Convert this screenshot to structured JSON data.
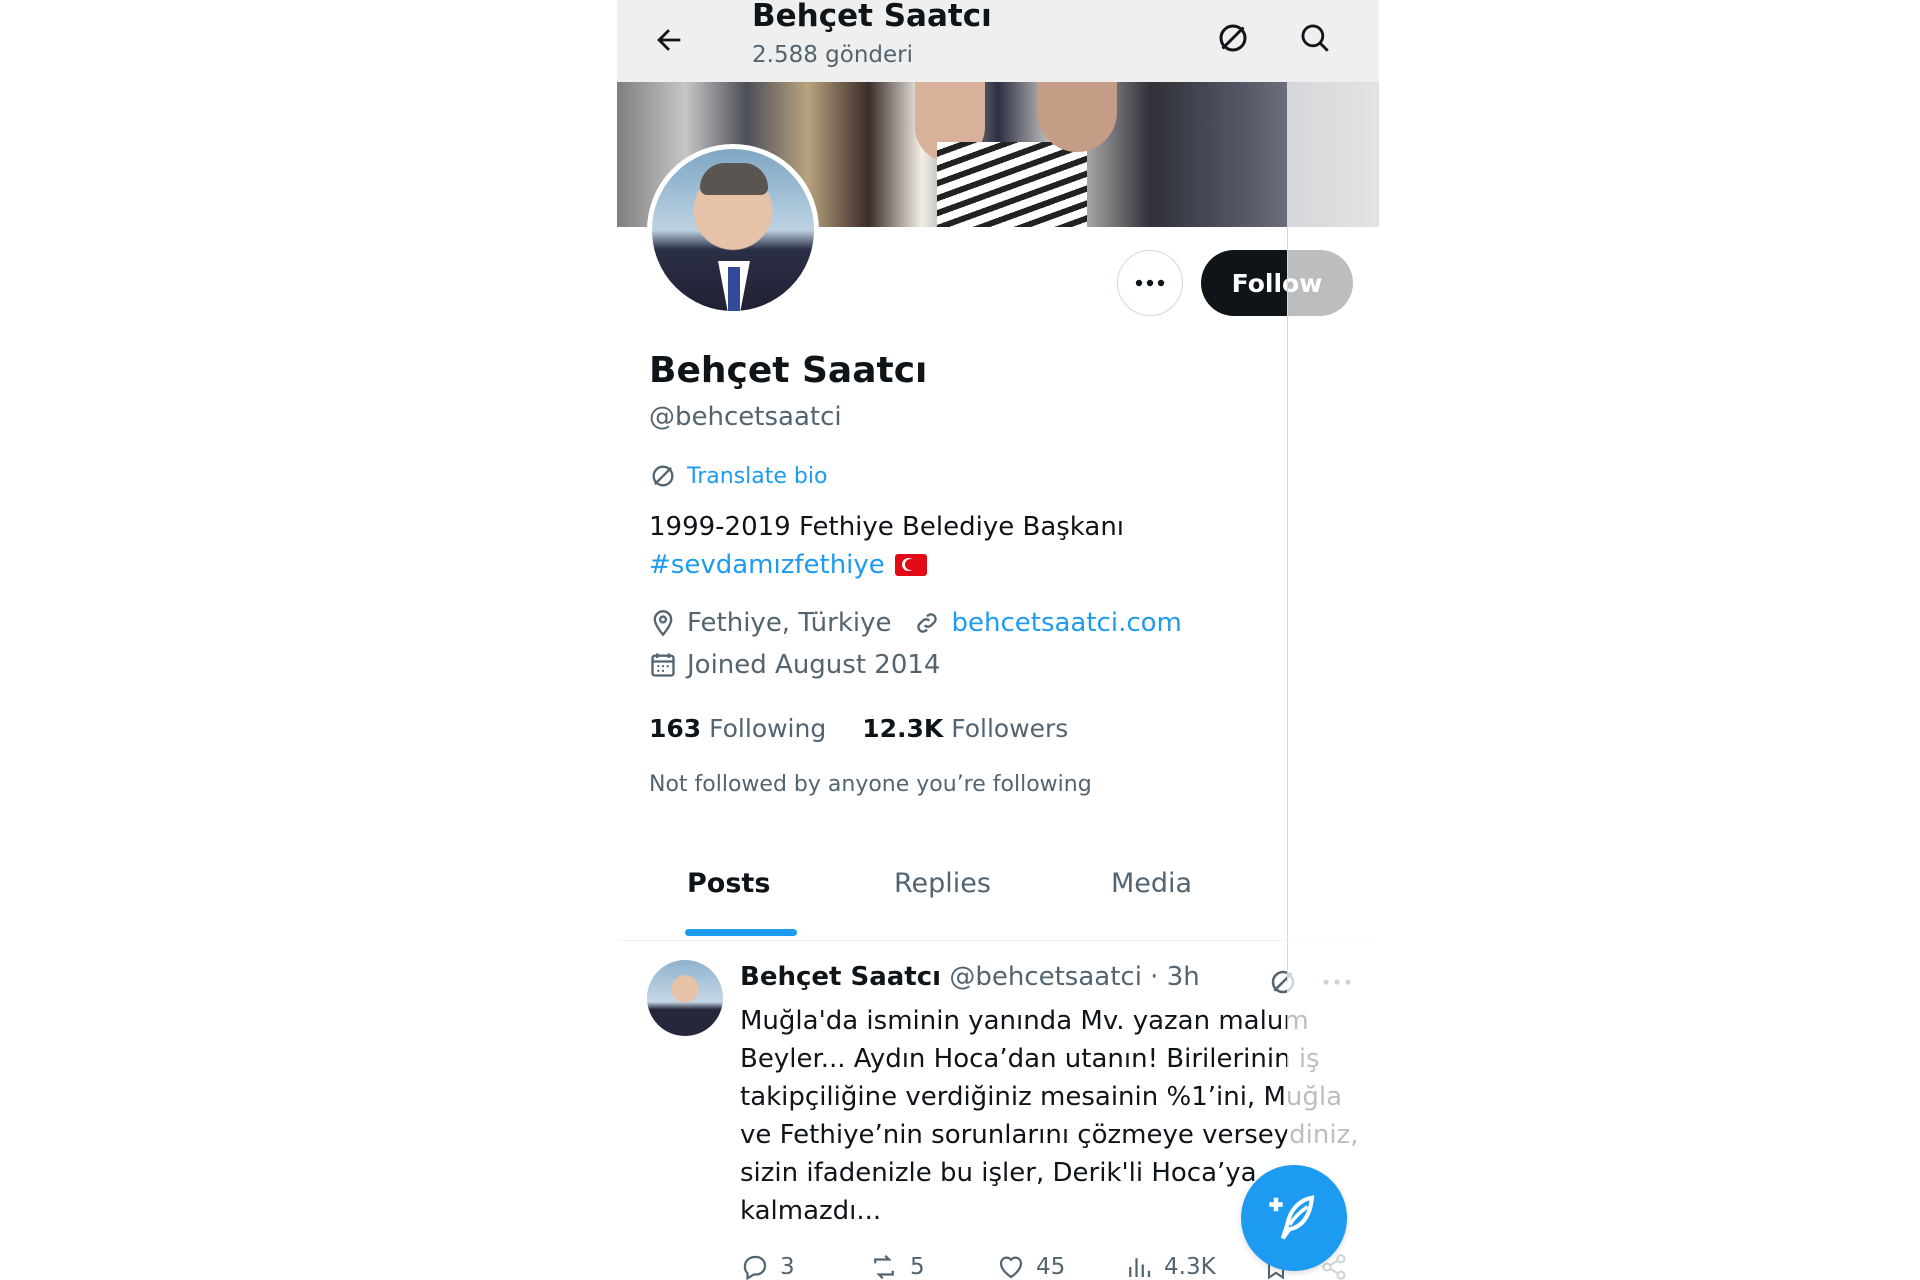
{
  "header": {
    "title": "Behçet Saatcı",
    "subtitle": "2.588 gönderi"
  },
  "profile": {
    "name": "Behçet Saatcı",
    "handle": "@behcetsaatci",
    "translate_bio": "Translate bio",
    "bio_line1": "1999-2019 Fethiye Belediye Başkanı",
    "bio_hashtag": "#sevdamızfethiye",
    "location": "Fethiye, Türkiye",
    "website": "behcetsaatci.com",
    "joined": "Joined August 2014",
    "following_count": "163",
    "following_label": "Following",
    "followers_count": "12.3K",
    "followers_label": "Followers",
    "not_followed": "Not followed by anyone you’re following",
    "follow_label": "Follow"
  },
  "tabs": [
    {
      "label": "Posts",
      "active": true
    },
    {
      "label": "Replies",
      "active": false
    },
    {
      "label": "Media",
      "active": false
    }
  ],
  "tweet": {
    "name": "Behçet Saatcı",
    "meta": "@behcetsaatci · 3h",
    "lines": [
      "Muğla'da isminin yanında Mv. yazan malum",
      "Beyler... Aydın Hoca’dan utanın! Birilerinin iş",
      "takipçiliğine verdiğiniz mesainin %1’ini, Muğla",
      "ve Fethiye’nin sorunlarını çözmeye verseydiniz,",
      "sizin ifadenizle bu işler, Derik'li Hoca’ya",
      "kalmazdı..."
    ],
    "replies": "3",
    "reposts": "5",
    "likes": "45",
    "views": "4.3K"
  },
  "icons": {
    "back": "arrow-left-icon",
    "translate": "translate-icon",
    "search": "search-icon",
    "more": "more-dots-icon",
    "location": "location-pin-icon",
    "link": "link-icon",
    "calendar": "calendar-icon",
    "reply": "reply-icon",
    "repost": "repost-icon",
    "like": "heart-icon",
    "views": "views-icon",
    "bookmark": "bookmark-icon",
    "share": "share-icon",
    "compose": "compose-icon"
  },
  "colors": {
    "accent": "#1d9bf0",
    "text": "#0f1419",
    "muted": "#536471",
    "follow_bg": "#0f1419",
    "flag_red": "#e30a17"
  }
}
